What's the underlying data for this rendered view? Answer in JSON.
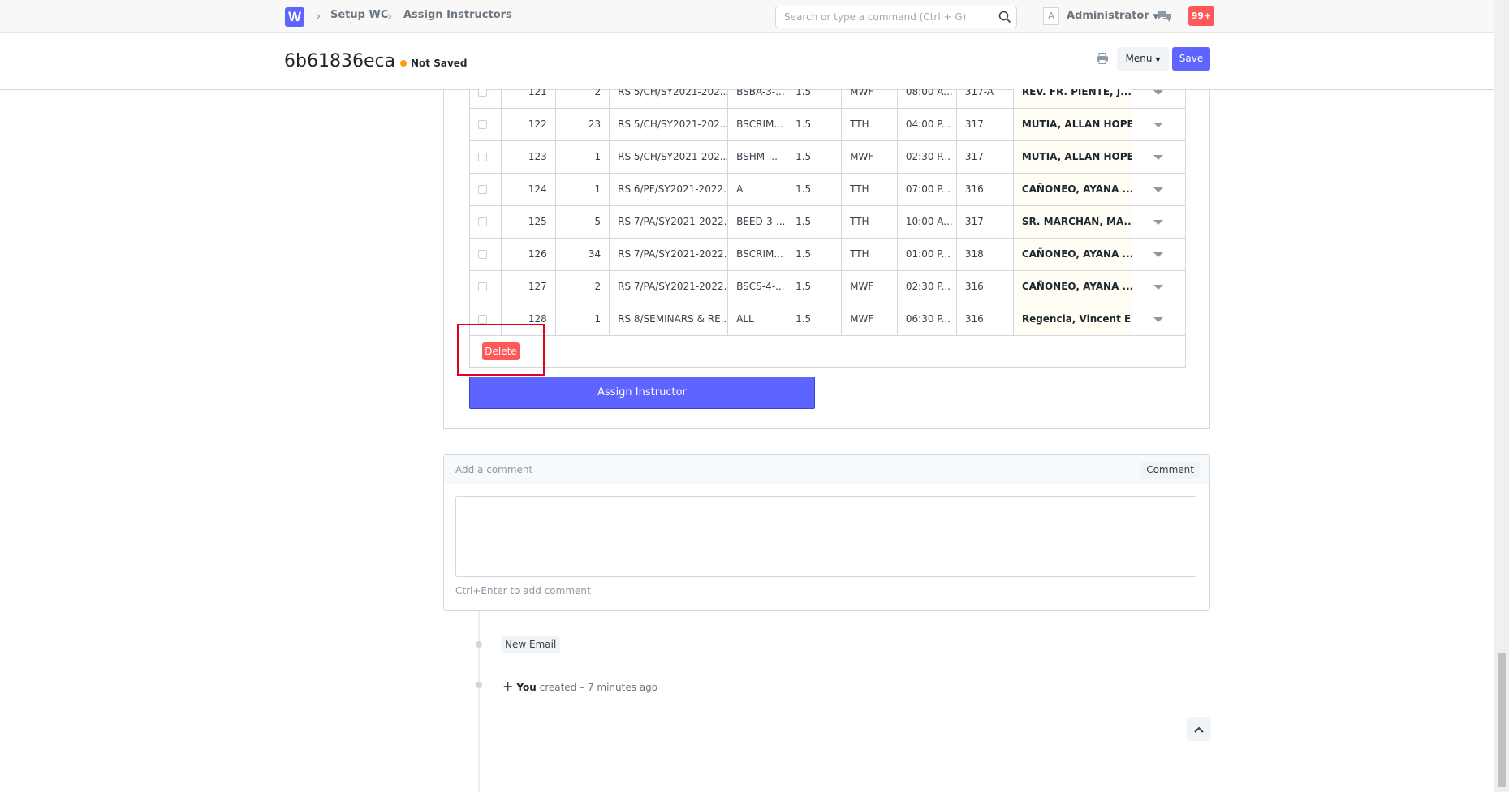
{
  "navbar": {
    "logo": "W",
    "breadcrumbs": [
      "Setup WC",
      "Assign Instructors"
    ],
    "search_placeholder": "Search or type a command (Ctrl + G)",
    "avatar_letter": "A",
    "user": "Administrator",
    "notifications": "99+"
  },
  "header": {
    "title": "6b61836eca",
    "status": "Not Saved",
    "menu_label": "Menu",
    "save_label": "Save"
  },
  "table": {
    "rows": [
      {
        "idx": "121",
        "qty": "2",
        "subject": "RS 5/CH/SY2021-202...",
        "section": "BSBA-3-...",
        "units": "1.5",
        "days": "MWF",
        "time": "08:00 A...",
        "room": "317-A",
        "instructor": "REV. FR. PIENTE, J..."
      },
      {
        "idx": "122",
        "qty": "23",
        "subject": "RS 5/CH/SY2021-202...",
        "section": "BSCRIM...",
        "units": "1.5",
        "days": "TTH",
        "time": "04:00 P...",
        "room": "317",
        "instructor": "MUTIA, ALLAN HOPE"
      },
      {
        "idx": "123",
        "qty": "1",
        "subject": "RS 5/CH/SY2021-202...",
        "section": "BSHM-...",
        "units": "1.5",
        "days": "MWF",
        "time": "02:30 P...",
        "room": "317",
        "instructor": "MUTIA, ALLAN HOPE"
      },
      {
        "idx": "124",
        "qty": "1",
        "subject": "RS 6/PF/SY2021-2022...",
        "section": "A",
        "units": "1.5",
        "days": "TTH",
        "time": "07:00 P...",
        "room": "316",
        "instructor": "CAÑONEO, AYANA ..."
      },
      {
        "idx": "125",
        "qty": "5",
        "subject": "RS 7/PA/SY2021-2022...",
        "section": "BEED-3-...",
        "units": "1.5",
        "days": "TTH",
        "time": "10:00 A...",
        "room": "317",
        "instructor": "SR. MARCHAN, MA...."
      },
      {
        "idx": "126",
        "qty": "34",
        "subject": "RS 7/PA/SY2021-2022...",
        "section": "BSCRIM...",
        "units": "1.5",
        "days": "TTH",
        "time": "01:00 P...",
        "room": "318",
        "instructor": "CAÑONEO, AYANA ..."
      },
      {
        "idx": "127",
        "qty": "2",
        "subject": "RS 7/PA/SY2021-2022...",
        "section": "BSCS-4-...",
        "units": "1.5",
        "days": "MWF",
        "time": "02:30 P...",
        "room": "316",
        "instructor": "CAÑONEO, AYANA ..."
      },
      {
        "idx": "128",
        "qty": "1",
        "subject": "RS 8/SEMINARS & RE...",
        "section": "ALL",
        "units": "1.5",
        "days": "MWF",
        "time": "06:30 P...",
        "room": "316",
        "instructor": "Regencia, Vincent E..."
      }
    ],
    "delete_label": "Delete"
  },
  "assign_label": "Assign Instructor",
  "comment": {
    "placeholder": "Add a comment",
    "button": "Comment",
    "hint": "Ctrl+Enter to add comment"
  },
  "timeline": {
    "new_email": "New Email",
    "actor": "You",
    "action": " created – 7 minutes ago"
  },
  "colors": {
    "primary": "#5e64ff",
    "danger": "#ff5858",
    "indicator": "#ffa00a",
    "highlight": "#e3001b"
  }
}
